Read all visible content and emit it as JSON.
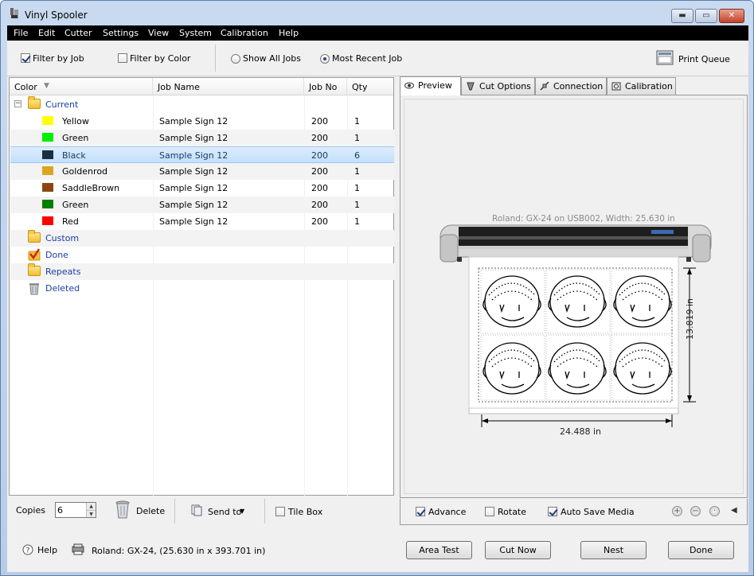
{
  "window": {
    "title": "Vinyl Spooler"
  },
  "menu": [
    "File",
    "Edit",
    "Cutter",
    "Settings",
    "View",
    "System",
    "Calibration",
    "Help"
  ],
  "toolbar": {
    "filter_by_job": {
      "label": "Filter by Job",
      "checked": true
    },
    "filter_by_color": {
      "label": "Filter by Color",
      "checked": false
    },
    "show_all_jobs": {
      "label": "Show All Jobs",
      "selected": false
    },
    "most_recent_job": {
      "label": "Most Recent Job",
      "selected": true
    },
    "print_queue": "Print Queue"
  },
  "table": {
    "headers": {
      "color": "Color",
      "job_name": "Job Name",
      "job_no": "Job No",
      "qty": "Qty"
    },
    "groups": {
      "current": "Current",
      "custom": "Custom",
      "done": "Done",
      "repeats": "Repeats",
      "deleted": "Deleted"
    },
    "rows": [
      {
        "color": "Yellow",
        "hex": "#ffff00",
        "job_name": "Sample Sign 12",
        "job_no": "200",
        "qty": "1"
      },
      {
        "color": "Green",
        "hex": "#00ee00",
        "job_name": "Sample Sign 12",
        "job_no": "200",
        "qty": "1"
      },
      {
        "color": "Black",
        "hex": "#1a3040",
        "job_name": "Sample Sign 12",
        "job_no": "200",
        "qty": "6"
      },
      {
        "color": "Goldenrod",
        "hex": "#daa520",
        "job_name": "Sample Sign 12",
        "job_no": "200",
        "qty": "1"
      },
      {
        "color": "SaddleBrown",
        "hex": "#8b4513",
        "job_name": "Sample Sign 12",
        "job_no": "200",
        "qty": "1"
      },
      {
        "color": "Green",
        "hex": "#008000",
        "job_name": "Sample Sign 12",
        "job_no": "200",
        "qty": "1"
      },
      {
        "color": "Red",
        "hex": "#ff0000",
        "job_name": "Sample Sign 12",
        "job_no": "200",
        "qty": "1"
      }
    ]
  },
  "left_bottom": {
    "copies_label": "Copies",
    "copies_value": "6",
    "delete": "Delete",
    "send_to": "Send to",
    "tile_box": "Tile Box"
  },
  "tabs": [
    "Preview",
    "Cut Options",
    "Connection",
    "Calibration"
  ],
  "preview": {
    "info": "Roland: GX-24 on USB002,   Width: 25.630 in",
    "height_dim": "13.819 in",
    "width_dim": "24.488 in"
  },
  "preview_options": {
    "advance": {
      "label": "Advance",
      "checked": true
    },
    "rotate": {
      "label": "Rotate",
      "checked": false
    },
    "auto_save_media": {
      "label": "Auto Save Media",
      "checked": true
    }
  },
  "status": {
    "help": "Help",
    "device": "Roland: GX-24,  (25.630 in x 393.701 in)"
  },
  "buttons": {
    "area_test": "Area Test",
    "cut_now": "Cut Now",
    "nest": "Nest",
    "done": "Done"
  }
}
